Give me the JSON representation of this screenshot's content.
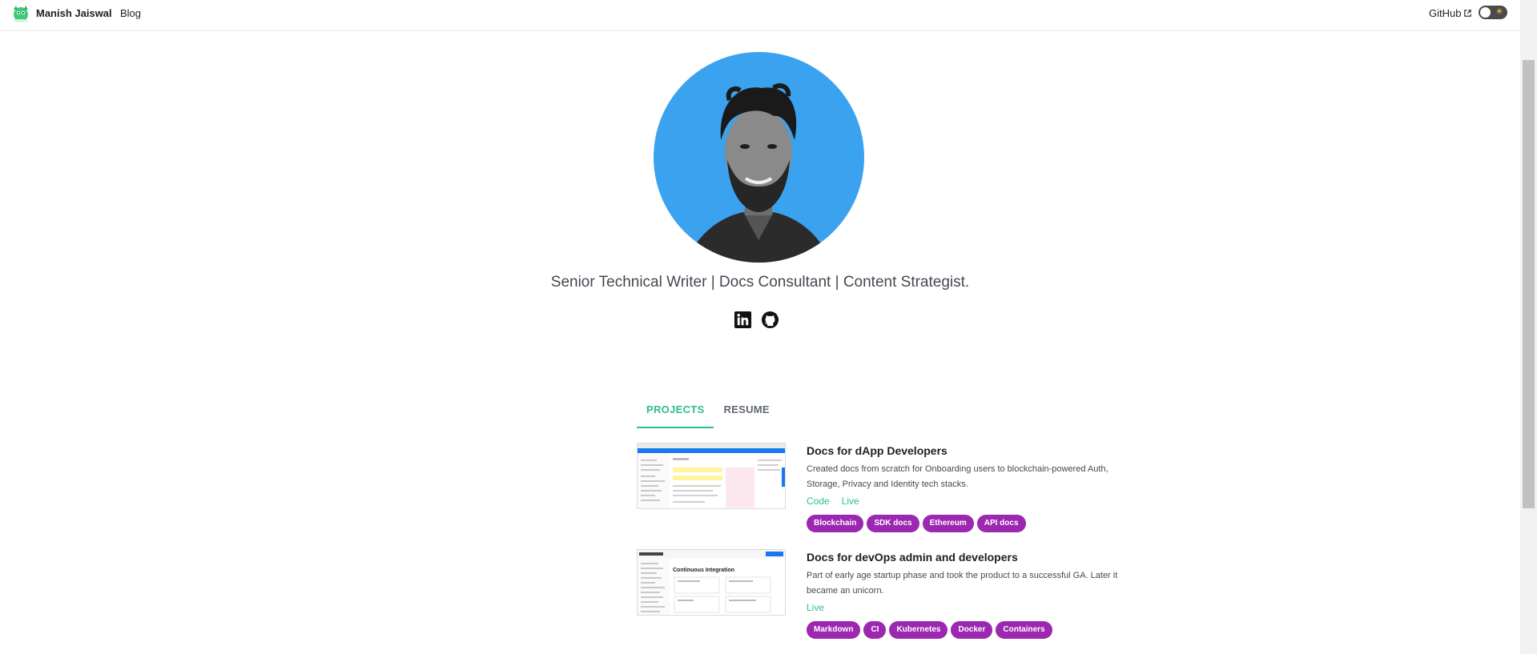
{
  "navbar": {
    "title": "Manish Jaiswal",
    "blog": "Blog",
    "github": "GitHub"
  },
  "hero": {
    "tagline": "Senior Technical Writer | Docs Consultant | Content Strategist.",
    "avatar_bg": "#3aa2ef",
    "social_icons": [
      "linkedin-icon",
      "github-icon"
    ]
  },
  "tabs": [
    {
      "label": "PROJECTS",
      "active": true
    },
    {
      "label": "RESUME",
      "active": false
    }
  ],
  "projects": [
    {
      "title": "Docs for dApp Developers",
      "description": "Created docs from scratch for Onboarding users to blockchain-powered Auth, Storage, Privacy and Identity tech stacks.",
      "links": [
        "Code",
        "Live"
      ],
      "tags": [
        "Blockchain",
        "SDK docs",
        "Ethereum",
        "API docs"
      ]
    },
    {
      "title": "Docs for devOps admin and developers",
      "description": "Part of early age startup phase and took the product to a successful GA. Later it became an unicorn.",
      "links": [
        "Live"
      ],
      "tags": [
        "Markdown",
        "CI",
        "Kubernetes",
        "Docker",
        "Containers"
      ],
      "thumbnail_heading": "Continuous Integration"
    }
  ],
  "colors": {
    "accent": "#2ebd8c",
    "tag": "#9c27b0"
  }
}
